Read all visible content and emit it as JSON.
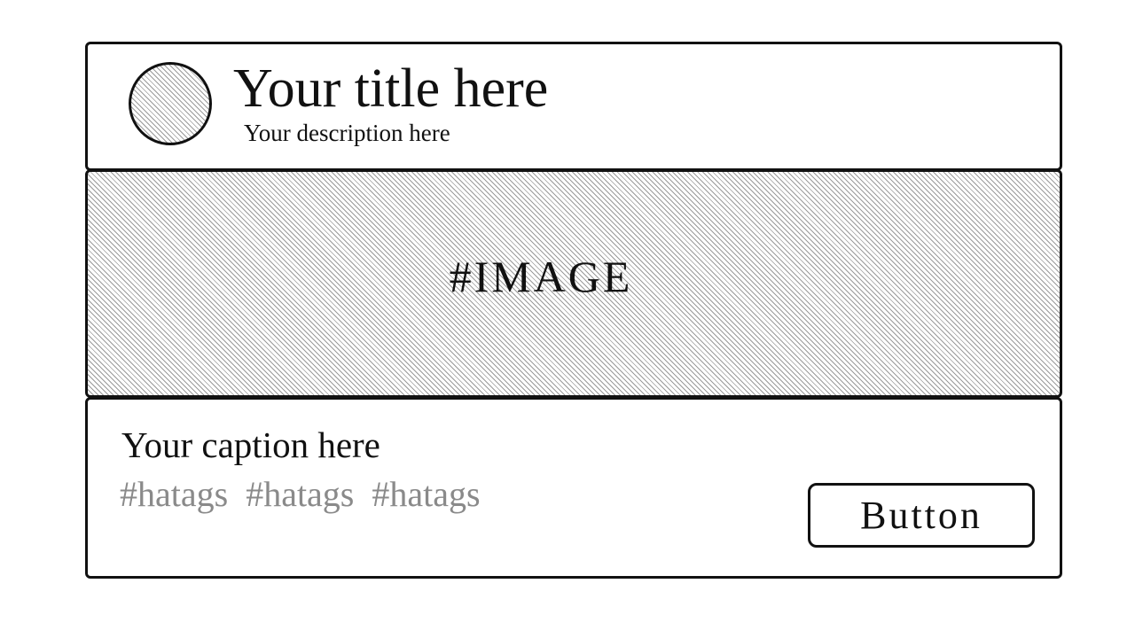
{
  "header": {
    "avatar_icon": "avatar-placeholder-icon",
    "title": "Your title here",
    "description": "Your description here"
  },
  "media": {
    "image_placeholder_label": "#IMAGE"
  },
  "footer": {
    "caption": "Your caption here",
    "hashtags": [
      "#hatags",
      "#hatags",
      "#hatags"
    ],
    "button_label": "Button"
  },
  "colors": {
    "border": "#111111",
    "text": "#111111",
    "hashtag": "#8a8a8a",
    "hatch": "#9a9a9a",
    "background": "#ffffff"
  }
}
